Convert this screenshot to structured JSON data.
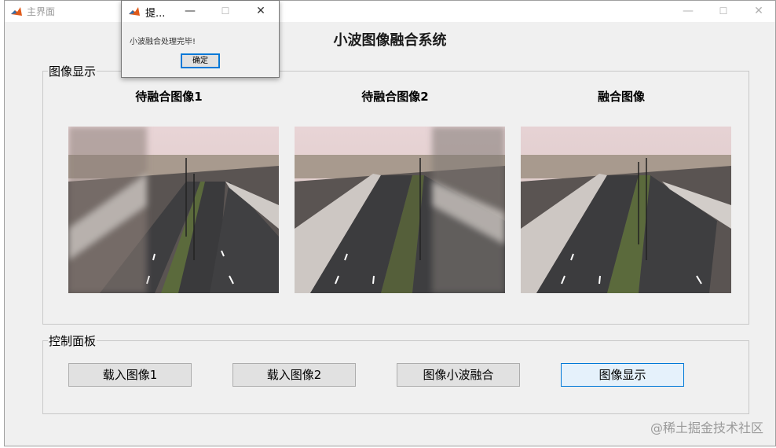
{
  "window": {
    "title": "主界面",
    "minimize": "—",
    "maximize": "☐",
    "close": "✕"
  },
  "system_title": "小波图像融合系统",
  "image_panel": {
    "label": "图像显示",
    "images": [
      {
        "title": "待融合图像1",
        "blur": "left"
      },
      {
        "title": "待融合图像2",
        "blur": "right"
      },
      {
        "title": "融合图像",
        "blur": "none"
      }
    ]
  },
  "control_panel": {
    "label": "控制面板",
    "buttons": [
      "载入图像1",
      "载入图像2",
      "图像小波融合",
      "图像显示"
    ]
  },
  "dialog": {
    "title": "提...",
    "message": "小波融合处理完毕!",
    "ok": "确定",
    "minimize": "—",
    "maximize": "☐",
    "close": "✕"
  },
  "watermark": "@稀土掘金技术社区",
  "colors": {
    "accent": "#0078d7",
    "window_bg": "#f0f0f0",
    "button_bg": "#e1e1e1"
  }
}
